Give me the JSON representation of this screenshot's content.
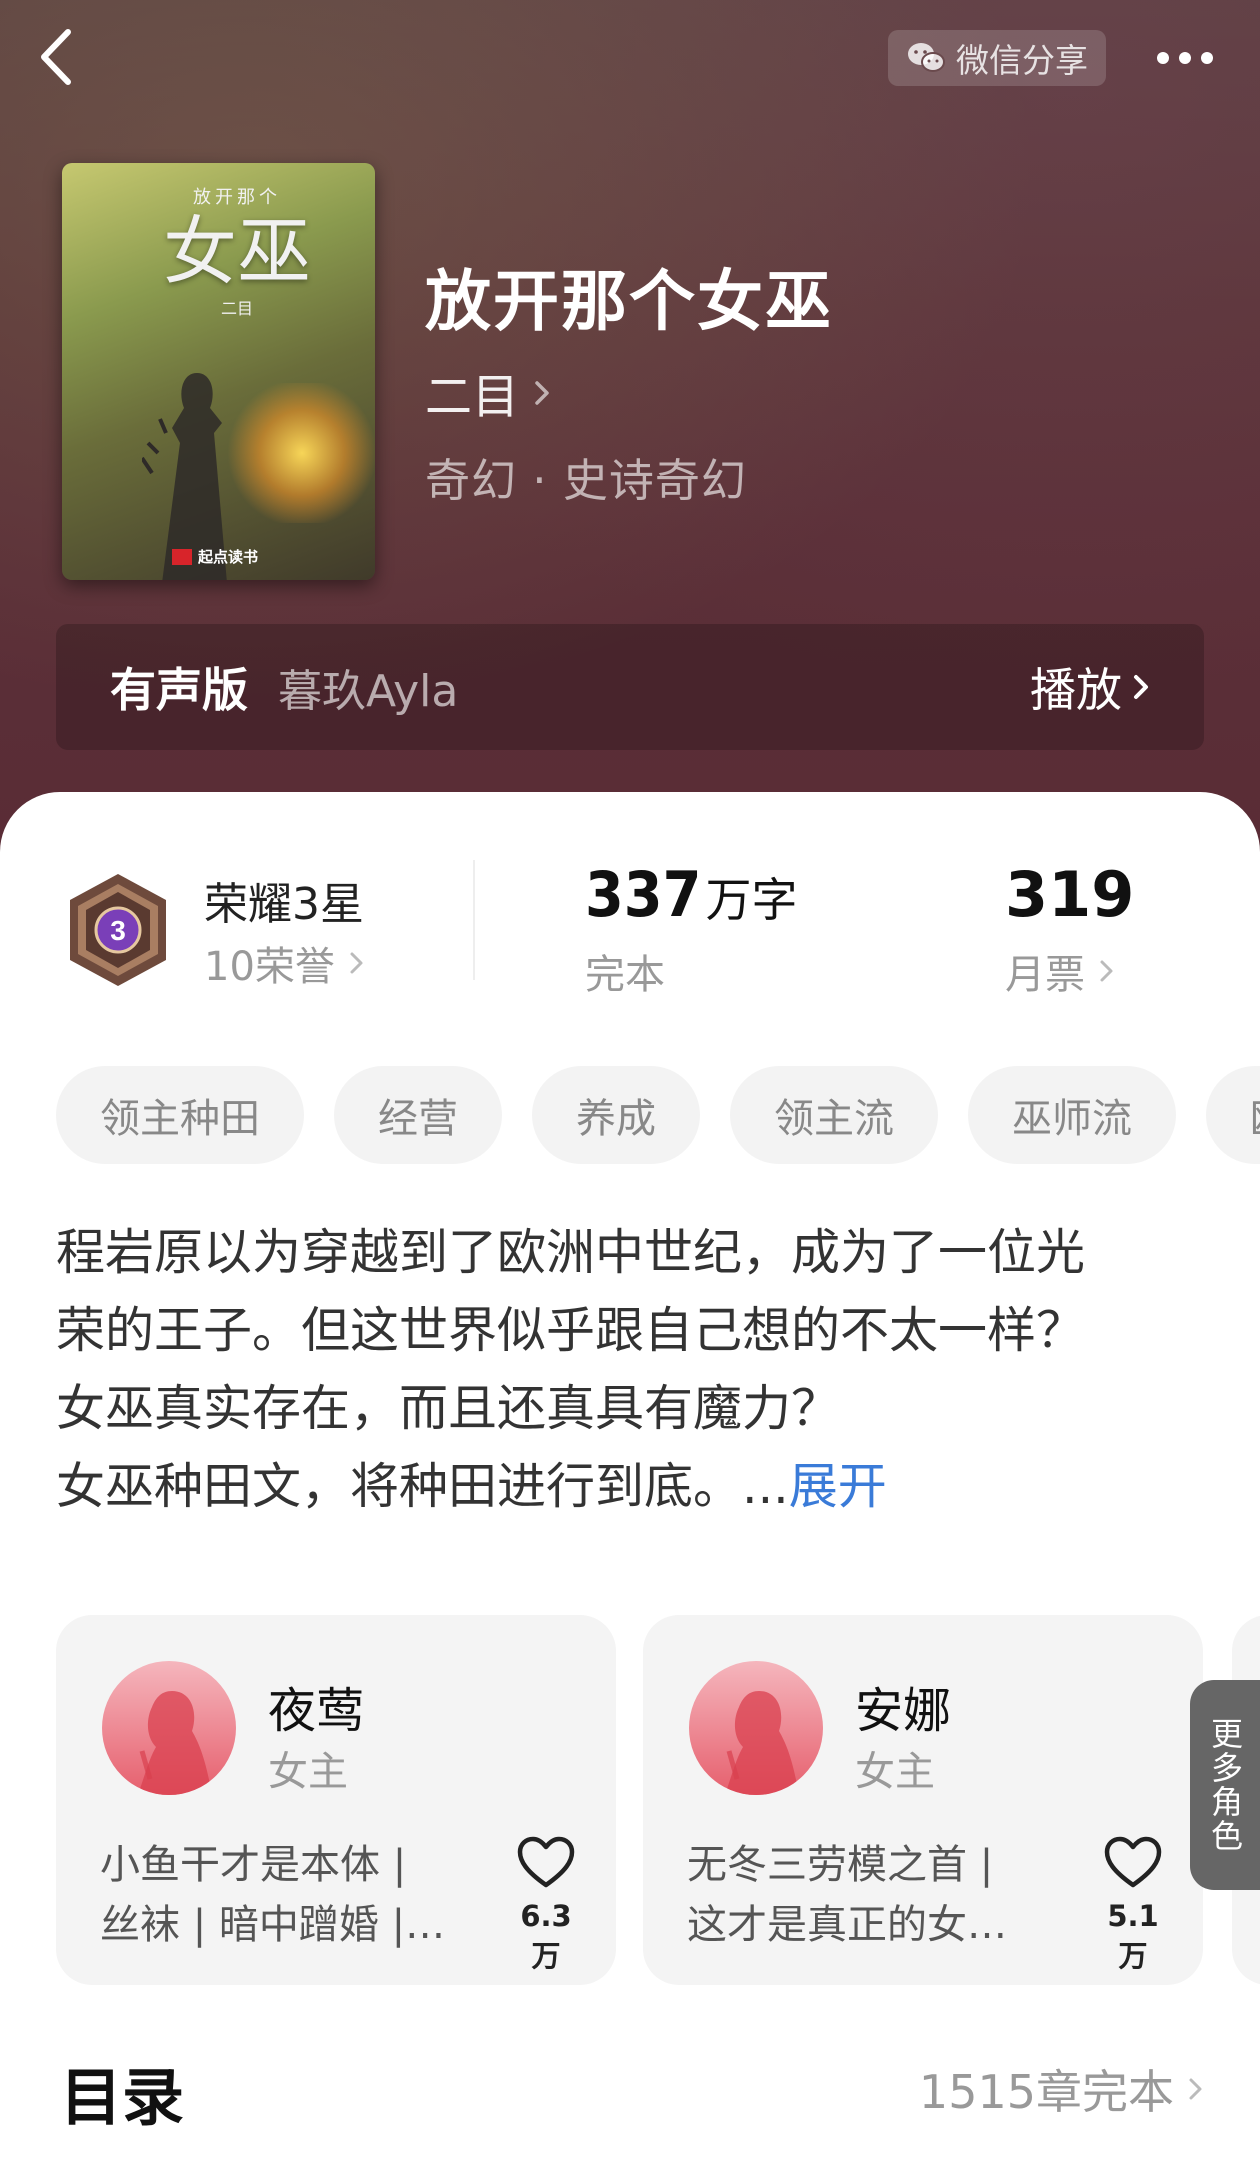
{
  "header": {
    "share_label": "微信分享",
    "colors": {
      "accent_link": "#3a7bd8",
      "tag_bg": "#f3f3f3",
      "avatar_pink": "#e65f6d"
    }
  },
  "book": {
    "cover": {
      "subtitle": "放开那个",
      "main": "女巫",
      "author": "二目",
      "publisher": "起点读书"
    },
    "title": "放开那个女巫",
    "author": "二目",
    "genre": "奇幻 · 史诗奇幻"
  },
  "audio": {
    "label": "有声版",
    "narrator": "暮玖Ayla",
    "play_label": "播放"
  },
  "stats": {
    "honor_badge_number": "3",
    "honor_title": "荣耀3星",
    "honor_sub": "10荣誉",
    "word_count": "337",
    "word_unit": "万字",
    "status": "完本",
    "monthly_votes": "319",
    "monthly_votes_label": "月票"
  },
  "tags": [
    "领主种田",
    "经营",
    "养成",
    "领主流",
    "巫师流",
    "欧"
  ],
  "synopsis": {
    "lines": [
      "程岩原以为穿越到了欧洲中世纪，成为了一位光",
      "荣的王子。但这世界似乎跟自己想的不太一样？",
      "女巫真实存在，而且还真具有魔力？",
      "女巫种田文，将种田进行到底。..."
    ],
    "expand_label": "展开"
  },
  "characters": [
    {
      "name": "夜莺",
      "role": "女主",
      "desc_line1": "小鱼干才是本体 |",
      "desc_line2": "丝袜 | 暗中蹭婚 |…",
      "likes": "6.3万"
    },
    {
      "name": "安娜",
      "role": "女主",
      "desc_line1": "无冬三劳模之首 |",
      "desc_line2": "这才是真正的女…",
      "likes": "5.1万"
    }
  ],
  "more_roles_label": "更多角色",
  "toc": {
    "title": "目录",
    "meta": "1515章完本"
  }
}
